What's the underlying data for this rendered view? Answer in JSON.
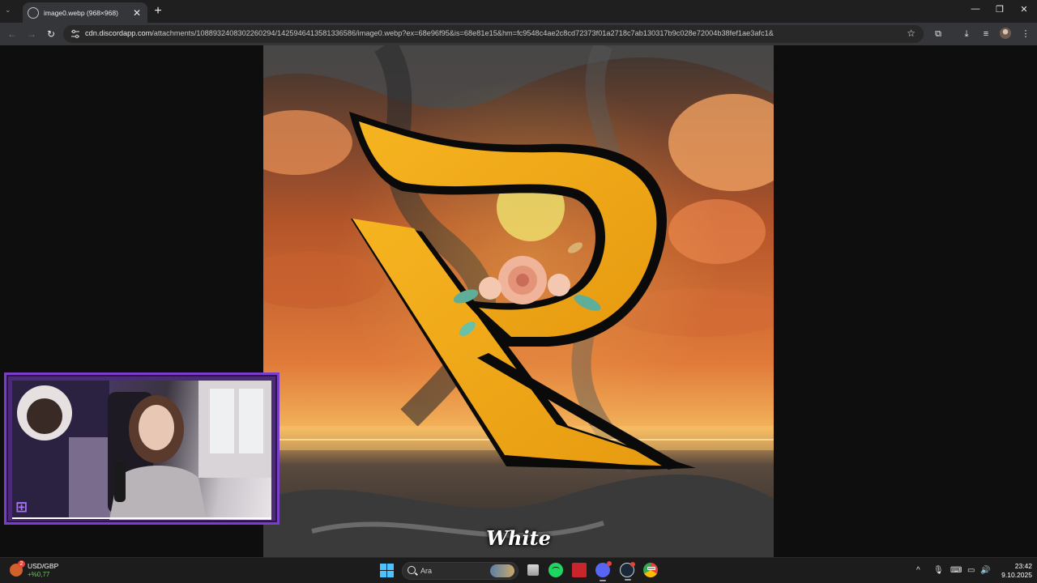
{
  "browser": {
    "tab": {
      "title": "image0.webp (968×968)",
      "close_glyph": "✕"
    },
    "new_tab_glyph": "+",
    "tab_search_glyph": "⌄",
    "window_controls": {
      "minimize": "—",
      "restore": "❐",
      "close": "✕"
    },
    "nav": {
      "back": "←",
      "forward": "→",
      "reload": "↻"
    },
    "address": {
      "host": "cdn.discordapp.com",
      "path": "/attachments/1088932408302260294/1425946413581336586/image0.webp?ex=68e96f95&is=68e81e15&hm=fc9548c4ae2c8cd72373f01a2718c7ab130317b9c028e72004b38fef1ae3afc1&"
    },
    "bookmark_glyph": "☆",
    "toolbar_icons": [
      "extensions-icon",
      "download-icon",
      "media-icon",
      "profile-avatar",
      "menu-icon"
    ],
    "toolbar_glyphs": {
      "extensions": "⧉",
      "download": "⤓",
      "media": "≡",
      "menu": "⋮"
    }
  },
  "artwork": {
    "caption": "White",
    "letter": "R",
    "colors": {
      "letter": "#f0a81a",
      "outline": "#0a0a0a",
      "sky": "#d86a32",
      "smoke": "#3a3a3a",
      "rose": "#f0b49a"
    }
  },
  "webcam": {
    "logo_glyph": "⊞",
    "colors": {
      "frame": "#7a3fc8",
      "border": "#4b2a78"
    }
  },
  "taskbar": {
    "ticker": {
      "pair": "USD/GBP",
      "change": "+%0,77",
      "badge": "2"
    },
    "search": {
      "placeholder": "Ara"
    },
    "apps": [
      "files-icon",
      "spotify-icon",
      "news-icon",
      "discord-icon",
      "steam-icon",
      "chrome-icon"
    ],
    "tray_glyphs": {
      "chevron": "^",
      "mic": "🎙",
      "keyboard": "⌨",
      "display": "▭",
      "volume": "🔊"
    },
    "clock": {
      "time": "23:42",
      "date": "9.10.2025"
    }
  }
}
